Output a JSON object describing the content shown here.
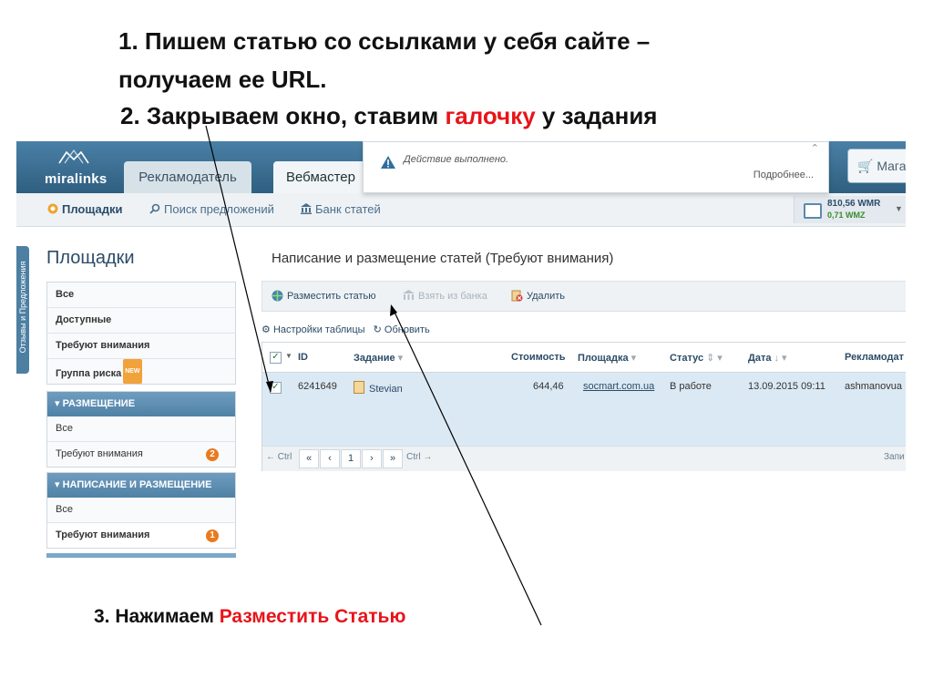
{
  "notes": {
    "step1_line1": "1. Пишем статью со ссылками у себя сайте –",
    "step1_line2": "получаем ее URL.",
    "step2_before": "2. Закрываем окно, ставим ",
    "step2_highlight": "галочку",
    "step2_after": " у задания",
    "step3_before": "3. Нажимаем ",
    "step3_highlight": "Разместить Статью",
    "highlight_color": "#e8141b"
  },
  "app": {
    "logo": "miralinks",
    "tabs": [
      {
        "label": "Рекламодатель"
      },
      {
        "label": "Вебмастер"
      }
    ],
    "market_button": "Мага"
  },
  "notification": {
    "message": "Действие выполнено.",
    "more_link": "Подробнее..."
  },
  "subnav": {
    "items": [
      {
        "label": "Площадки"
      },
      {
        "label": "Поиск предложений"
      },
      {
        "label": "Банк статей"
      }
    ],
    "wallet_wmr": "810,56 WMR",
    "wallet_wmz": "0,71 WMZ"
  },
  "sidebar": {
    "feedback_tab": "Отзывы и Предложения",
    "title": "Площадки",
    "group1": [
      "Все",
      "Доступные",
      "Требуют внимания",
      "Группа риска"
    ],
    "new_tag": "NEW",
    "group2": {
      "header": "РАЗМЕЩЕНИЕ",
      "items": [
        {
          "label": "Все"
        },
        {
          "label": "Требуют внимания",
          "badge": "2"
        }
      ]
    },
    "group3": {
      "header": "НАПИСАНИЕ И РАЗМЕЩЕНИЕ",
      "items": [
        {
          "label": "Все"
        },
        {
          "label": "Требуют внимания",
          "badge": "1"
        }
      ]
    }
  },
  "main": {
    "title": "Написание и размещение статей (Требуют внимания)",
    "toolbar": {
      "place_article": "Разместить статью",
      "take_from_bank": "Взять из банка",
      "delete": "Удалить"
    },
    "table_settings": "Настройки таблицы",
    "refresh": "Обновить",
    "columns": [
      "ID",
      "Задание",
      "Стоимость",
      "Площадка",
      "Статус",
      "Дата",
      "Рекламодат"
    ],
    "rows": [
      {
        "id": "6241649",
        "task": "Stevian",
        "cost": "644,46",
        "site": "socmart.com.ua",
        "status": "В работе",
        "date": "13.09.2015 09:11",
        "advertiser": "ashmanovua"
      }
    ],
    "pager": {
      "prev_hint": "← Ctrl",
      "first": "«",
      "prev": "‹",
      "page": "1",
      "next": "›",
      "last": "»",
      "next_hint": "Ctrl →",
      "right_text": "Запи"
    }
  }
}
